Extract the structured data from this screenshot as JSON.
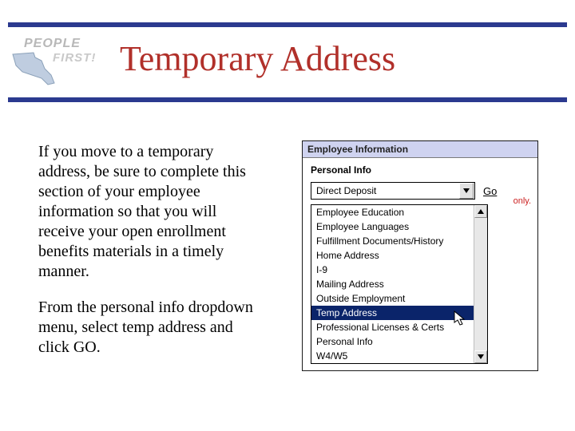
{
  "logo": {
    "line1": "PEOPLE",
    "line2": "FIRST!"
  },
  "title": "Temporary Address",
  "paragraphs": {
    "p1": "If you move to a temporary address, be sure to complete this section of your employee information so that you will receive your open enrollment benefits materials in a timely manner.",
    "p2": "From the personal info dropdown menu, select temp address and click GO."
  },
  "shot": {
    "header": "Employee Information",
    "section_label": "Personal Info",
    "select_value": "Direct Deposit",
    "go_label": "Go",
    "partial_note": "only.",
    "options": [
      "Employee Education",
      "Employee Languages",
      "Fulfillment Documents/History",
      "Home Address",
      "I-9",
      "Mailing Address",
      "Outside Employment",
      "Temp Address",
      "Professional Licenses & Certs",
      "Personal Info",
      "W4/W5"
    ],
    "selected_index": 7
  }
}
